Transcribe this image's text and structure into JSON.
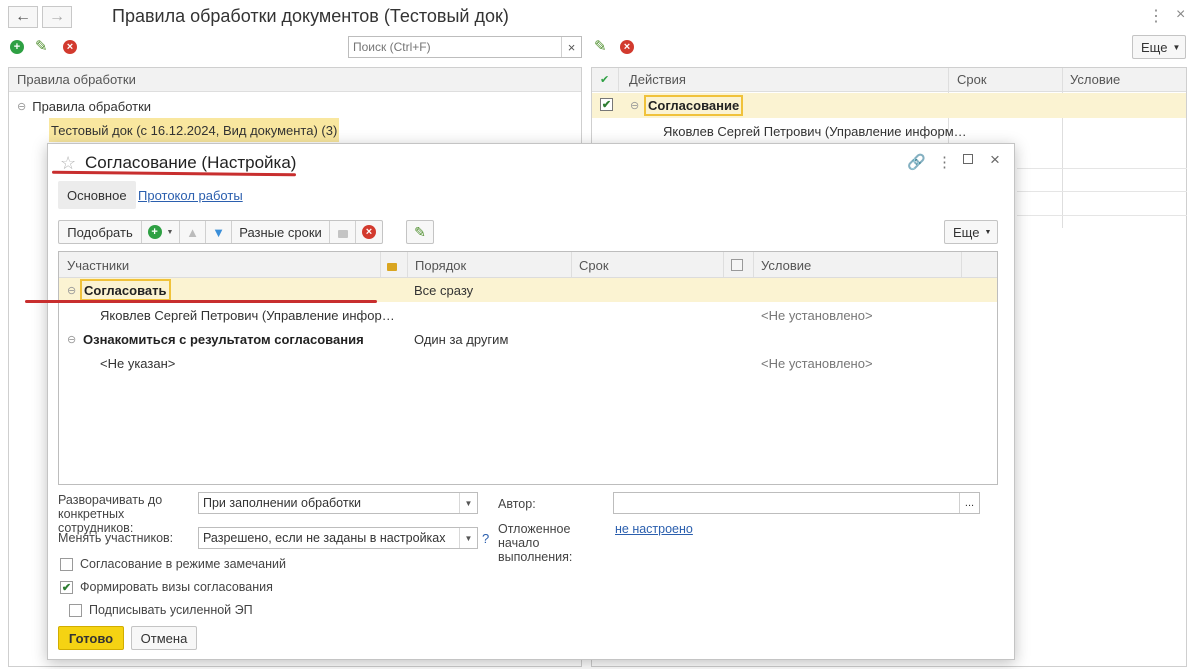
{
  "window": {
    "title": "Правила обработки документов (Тестовый док)",
    "back_icon": "arrow-left-icon",
    "forward_icon": "arrow-right-icon"
  },
  "left_toolbar": {
    "search_placeholder": "Поиск (Ctrl+F)",
    "clear_glyph": "×"
  },
  "left_pane": {
    "header": "Правила обработки",
    "tree_root": "Правила обработки",
    "selected_item": "Тестовый док (с 16.12.2024, Вид документа) (3)"
  },
  "right_toolbar": {
    "more_label": "Еще"
  },
  "right_pane": {
    "columns": [
      "Действия",
      "Срок",
      "Условие"
    ],
    "row1": "Согласование",
    "row2": "Яковлев Сергей Петрович (Управление информ…"
  },
  "dialog": {
    "title": "Согласование (Настройка)",
    "tabs": {
      "main": "Основное",
      "log": "Протокол работы"
    },
    "toolbar": {
      "pick_label": "Подобрать",
      "different_terms_label": "Разные сроки",
      "more_label": "Еще"
    },
    "grid": {
      "columns": {
        "participants": "Участники",
        "order": "Порядок",
        "term": "Срок",
        "condition": "Условие"
      },
      "rows": [
        {
          "participant": "Согласовать",
          "order": "Все сразу",
          "condition": ""
        },
        {
          "participant": "Яковлев Сергей Петрович (Управление инфор…",
          "order": "",
          "condition": "<Не установлено>"
        },
        {
          "participant": "Ознакомиться с результатом согласования",
          "order": "Один за другим",
          "condition": ""
        },
        {
          "participant": "<Не указан>",
          "order": "",
          "condition": "<Не установлено>"
        }
      ]
    },
    "form": {
      "expand_label": "Разворачивать до конкретных сотрудников:",
      "expand_value": "При заполнении обработки",
      "change_label": "Менять участников:",
      "change_value": "Разрешено, если не заданы в настройках",
      "help_glyph": "?",
      "author_label": "Автор:",
      "author_value": "",
      "author_button": "...",
      "deferred_label": "Отложенное начало выполнения:",
      "deferred_value": "не настроено",
      "remarks_mode_label": "Согласование в режиме замечаний",
      "remarks_mode_checked": false,
      "form_visas_label": "Формировать визы согласования",
      "form_visas_checked": true,
      "sign_label": "Подписывать усиленной ЭП",
      "sign_checked": false
    },
    "buttons": {
      "ok": "Готово",
      "cancel": "Отмена"
    }
  }
}
